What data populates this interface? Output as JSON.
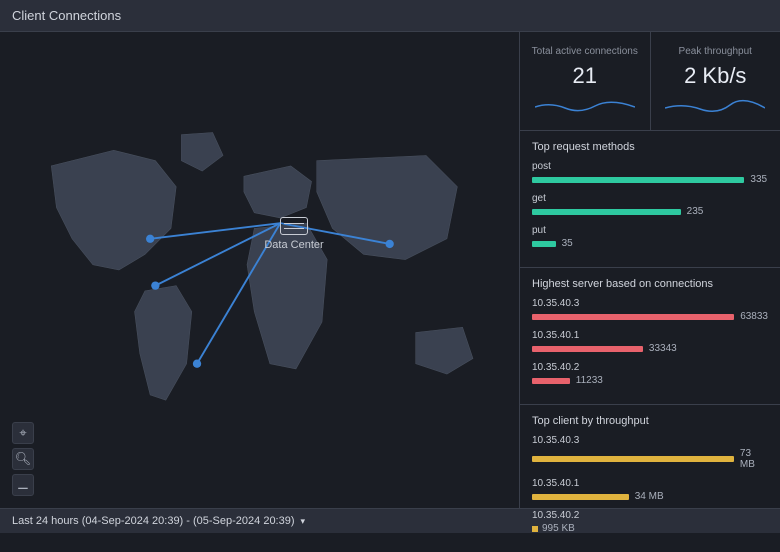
{
  "header": {
    "title": "Client Connections"
  },
  "map": {
    "datacenter_label": "Data Center",
    "controls": {
      "home": "⌂",
      "zoom_in": "⊕",
      "zoom_out": "⊖"
    }
  },
  "stats": {
    "active": {
      "label": "Total active connections",
      "value": "21"
    },
    "throughput": {
      "label": "Peak throughput",
      "value": "2 Kb/s"
    }
  },
  "methods": {
    "title": "Top request methods",
    "rows": [
      {
        "label": "post",
        "value": "335",
        "pct": 90
      },
      {
        "label": "get",
        "value": "235",
        "pct": 63
      },
      {
        "label": "put",
        "value": "35",
        "pct": 10
      }
    ]
  },
  "servers": {
    "title": "Highest server based on connections",
    "rows": [
      {
        "label": "10.35.40.3",
        "value": "63833",
        "pct": 90
      },
      {
        "label": "10.35.40.1",
        "value": "33343",
        "pct": 47
      },
      {
        "label": "10.35.40.2",
        "value": "11233",
        "pct": 16
      }
    ]
  },
  "clients": {
    "title": "Top client by throughput",
    "rows": [
      {
        "label": "10.35.40.3",
        "value": "73 MB",
        "pct": 88
      },
      {
        "label": "10.35.40.1",
        "value": "34 MB",
        "pct": 41
      },
      {
        "label": "10.35.40.2",
        "value": "995 KB",
        "pct": 0
      }
    ]
  },
  "footer": {
    "range": "Last 24 hours (04-Sep-2024 20:39) - (05-Sep-2024 20:39)"
  },
  "chart_data": [
    {
      "type": "bar",
      "title": "Top request methods",
      "categories": [
        "post",
        "get",
        "put"
      ],
      "values": [
        335,
        235,
        35
      ]
    },
    {
      "type": "bar",
      "title": "Highest server based on connections",
      "categories": [
        "10.35.40.3",
        "10.35.40.1",
        "10.35.40.2"
      ],
      "values": [
        63833,
        33343,
        11233
      ]
    },
    {
      "type": "bar",
      "title": "Top client by throughput",
      "categories": [
        "10.35.40.3",
        "10.35.40.1",
        "10.35.40.2"
      ],
      "values": [
        73,
        34,
        0.995
      ],
      "unit": "MB"
    }
  ],
  "colors": {
    "teal": "#2ec9a0",
    "red": "#e8626c",
    "yellow": "#e0b33e",
    "spark": "#3b82d4"
  }
}
